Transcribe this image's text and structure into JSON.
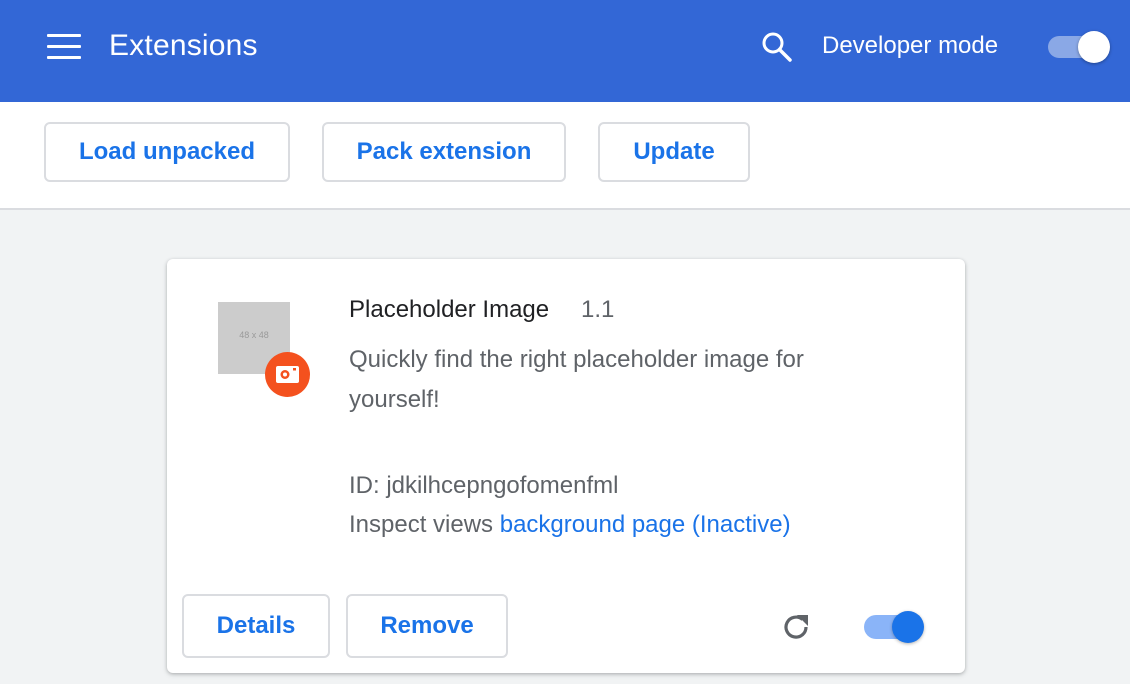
{
  "header": {
    "title": "Extensions",
    "menu_icon": "hamburger-menu-icon",
    "search_icon": "search-icon",
    "developer_mode_label": "Developer mode",
    "developer_mode_enabled": true,
    "background_color": "#3367d6"
  },
  "toolbar": {
    "load_unpacked_label": "Load unpacked",
    "pack_extension_label": "Pack extension",
    "update_label": "Update"
  },
  "extension": {
    "icon_placeholder_text": "48 x 48",
    "badge_icon": "camera-icon",
    "badge_color": "#f4511e",
    "name": "Placeholder Image",
    "version": "1.1",
    "description": "Quickly find the right placeholder image for yourself!",
    "id_text": "ID: jdkilhcepngofomenfml",
    "inspect_label": "Inspect views",
    "inspect_link": "background page (Inactive)",
    "details_label": "Details",
    "remove_label": "Remove",
    "reload_icon": "reload-icon",
    "enabled": true
  },
  "colors": {
    "accent": "#1a73e8",
    "toggle_track": "#8ab4f8",
    "text_primary": "#202124",
    "text_secondary": "#5f6368"
  }
}
